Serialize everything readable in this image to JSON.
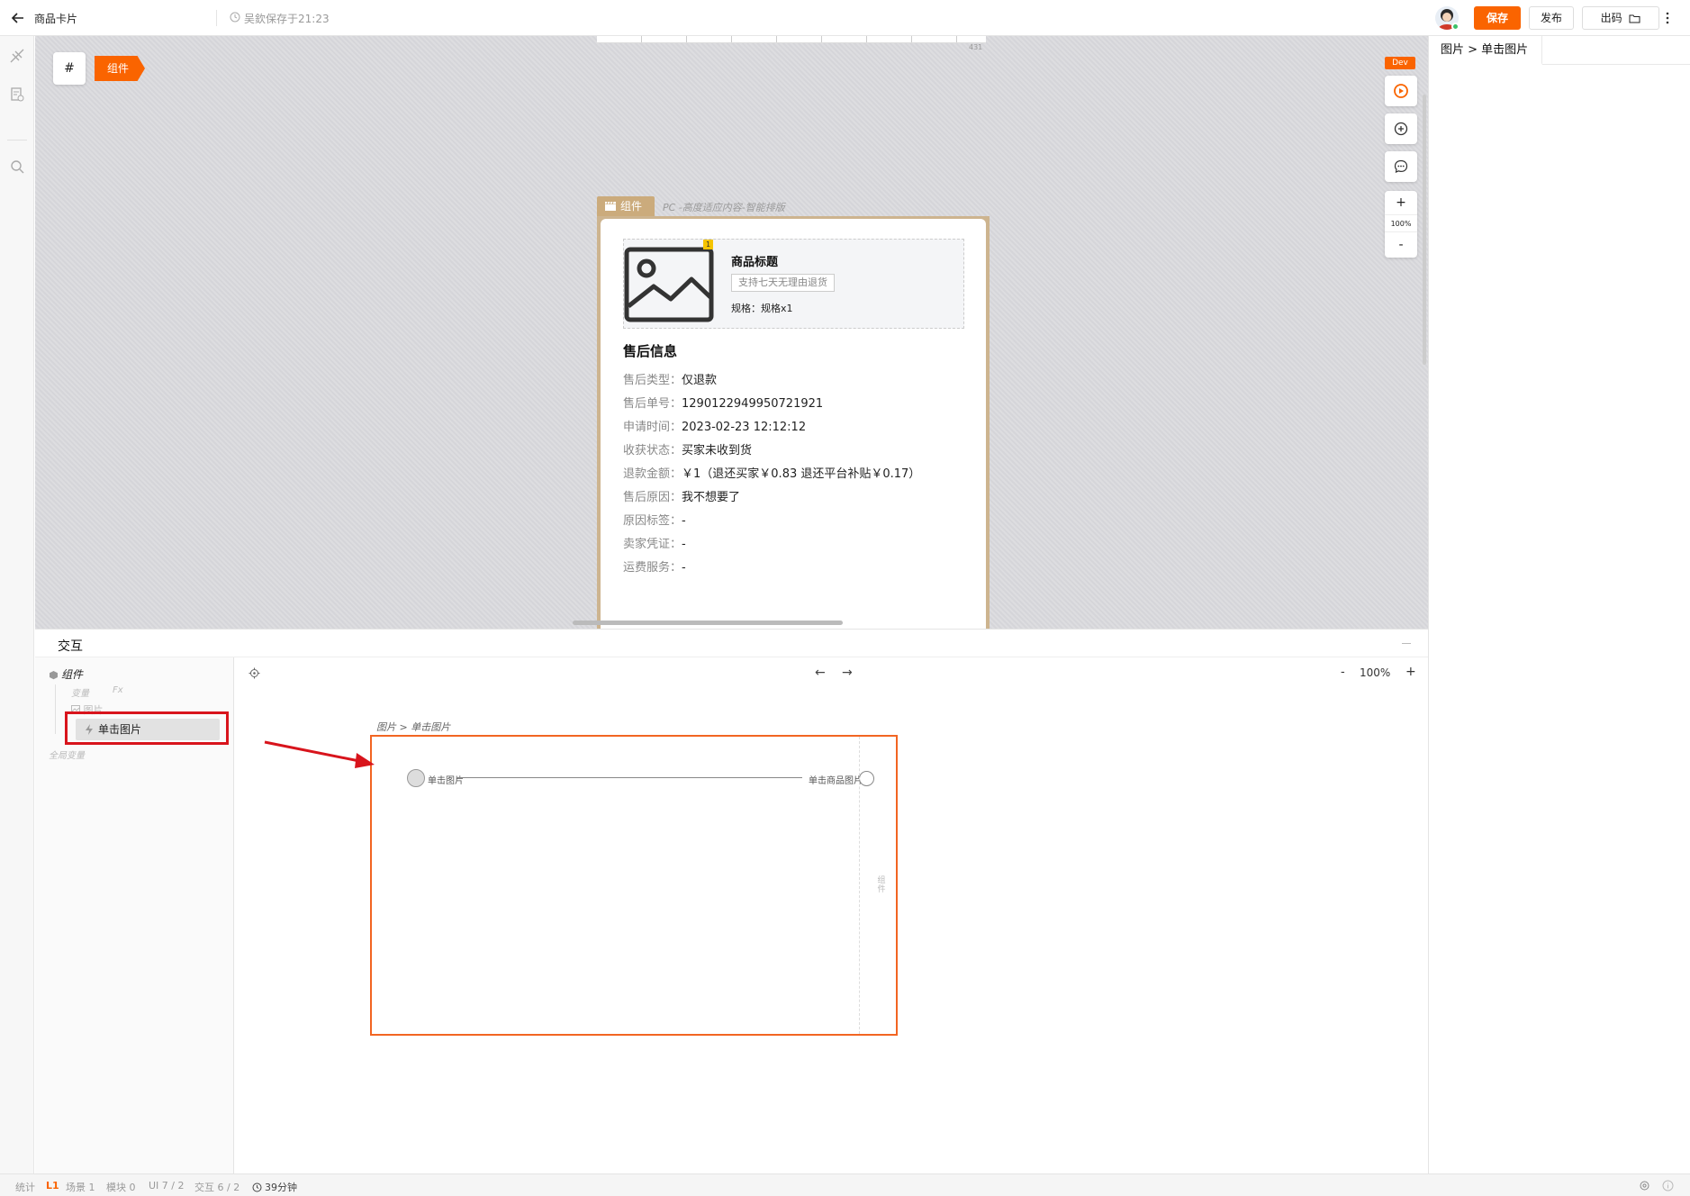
{
  "topbar": {
    "title": "商品卡片",
    "save_status": "吴欽保存于21:23",
    "save_label": "保存",
    "publish_label": "发布",
    "code_label": "出码"
  },
  "canvas": {
    "hash_label": "#",
    "component_tag": "组件",
    "ruler_number": "431",
    "frame_tag": "组件",
    "frame_desc": "PC -高度适应内容-智能排版",
    "dev_badge": "Dev",
    "zoom": {
      "plus": "+",
      "percent": "100%",
      "minus": "-"
    }
  },
  "card": {
    "product_title": "商品标题",
    "badge": "1",
    "return_tag": "支持七天无理由退货",
    "spec": "规格：规格x1",
    "section_title": "售后信息",
    "rows": [
      {
        "key": "售后类型：",
        "value": "仅退款"
      },
      {
        "key": "售后单号：",
        "value": "1290122949950721921"
      },
      {
        "key": "申请时间：",
        "value": "2023-02-23 12:12:12"
      },
      {
        "key": "收获状态：",
        "value": "买家未收到货"
      },
      {
        "key": "退款金额：",
        "value": "￥1（退还买家￥0.83 退还平台补贴￥0.17）"
      },
      {
        "key": "售后原因：",
        "value": "我不想要了"
      },
      {
        "key": "原因标签：",
        "value": "-"
      },
      {
        "key": "卖家凭证：",
        "value": "-"
      },
      {
        "key": "运费服务：",
        "value": "-"
      }
    ]
  },
  "right_panel": {
    "tab": "图片 > 单击图片"
  },
  "interaction": {
    "title": "交互",
    "tree": {
      "root": "组件",
      "variable": "变量",
      "fx": "Fx",
      "image": "图片",
      "selected_item": "单击图片",
      "global_var": "全局变量"
    },
    "toolbar": {
      "prev": "←",
      "next": "→",
      "zoom_minus": "-",
      "zoom_pct": "100%",
      "zoom_plus": "+"
    },
    "flow": {
      "caption": "图片 > 单击图片",
      "start_label": "单击图片",
      "end_label": "单击商品图片",
      "side_label": "组件"
    }
  },
  "status": {
    "stats": "统计",
    "level": "L1",
    "scene": "场景 1",
    "module": "模块 0",
    "ui": "UI 7 / 2",
    "interaction": "交互 6 / 2",
    "time": "39分钟"
  },
  "colors": {
    "accent": "#fa6400",
    "frame": "#cdb48f",
    "highlight": "#d8141c",
    "flow_border": "#f26522"
  }
}
